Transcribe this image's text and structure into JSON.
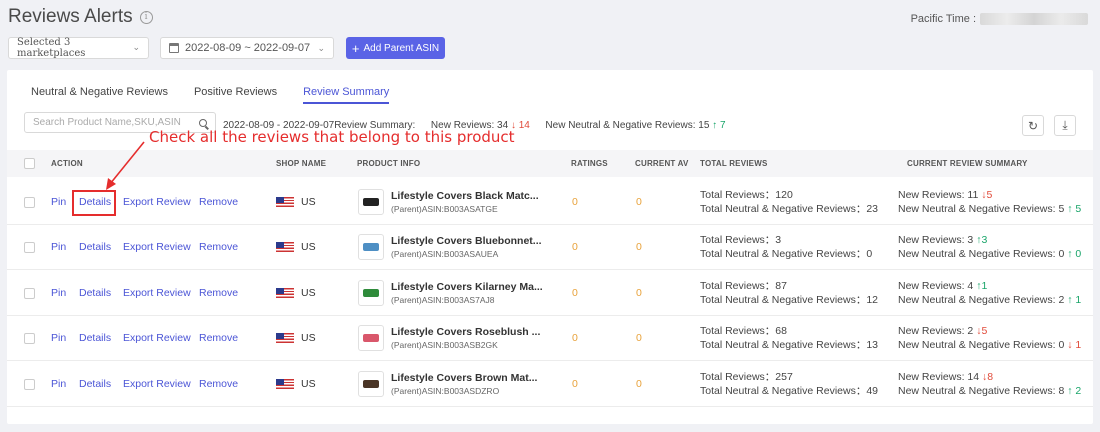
{
  "header": {
    "title": "Reviews Alerts",
    "pacific_label": "Pacific Time :"
  },
  "filters": {
    "marketplaces": "Selected 3 marketplaces",
    "date_range": "2022-08-09 ~ 2022-09-07",
    "add_button": "Add Parent ASIN"
  },
  "tabs": [
    {
      "label": "Neutral & Negative Reviews",
      "active": false
    },
    {
      "label": "Positive Reviews",
      "active": false
    },
    {
      "label": "Review Summary",
      "active": true
    }
  ],
  "search": {
    "placeholder": "Search Product Name,SKU,ASIN"
  },
  "summary": {
    "period": "2022-08-09 - 2022-09-07",
    "label": "Review Summary:",
    "new_reviews_label": "New Reviews: 34",
    "new_reviews_change": "14",
    "new_neg_label": "New Neutral & Negative Reviews: 15",
    "new_neg_change": "7"
  },
  "annotation": "Check all the reviews that belong to this product",
  "columns": {
    "action": "ACTION",
    "shop": "SHOP NAME",
    "product": "PRODUCT INFO",
    "ratings": "RATINGS",
    "current_av": "CURRENT AV",
    "total": "TOTAL REVIEWS",
    "current_summary": "CURRENT REVIEW SUMMARY"
  },
  "actions": {
    "pin": "Pin",
    "details": "Details",
    "export": "Export Review",
    "remove": "Remove"
  },
  "rows": [
    {
      "shop": "US",
      "name": "Lifestyle Covers Black Matc...",
      "asin": "(Parent)ASIN:B003ASATGE",
      "color": "#222222",
      "ratings": "0",
      "av": "0",
      "total": "Total Reviews：120",
      "total_neg": "Total Neutral & Negative Reviews：23",
      "new_label": "New Reviews: 11",
      "new_dir": "down",
      "new_val": "5",
      "neg_label": "New Neutral & Negative Reviews: 5",
      "neg_dir": "up",
      "neg_val": "5"
    },
    {
      "shop": "US",
      "name": "Lifestyle Covers Bluebonnet...",
      "asin": "(Parent)ASIN:B003ASAUEA",
      "color": "#4e8fc4",
      "ratings": "0",
      "av": "0",
      "total": "Total Reviews：3",
      "total_neg": "Total Neutral & Negative Reviews：0",
      "new_label": "New Reviews: 3",
      "new_dir": "up",
      "new_val": "3",
      "neg_label": "New Neutral & Negative Reviews: 0",
      "neg_dir": "up",
      "neg_val": "0"
    },
    {
      "shop": "US",
      "name": "Lifestyle Covers Kilarney Ma...",
      "asin": "(Parent)ASIN:B003AS7AJ8",
      "color": "#2e8b3a",
      "ratings": "0",
      "av": "0",
      "total": "Total Reviews：87",
      "total_neg": "Total Neutral & Negative Reviews：12",
      "new_label": "New Reviews: 4",
      "new_dir": "up",
      "new_val": "1",
      "neg_label": "New Neutral & Negative Reviews: 2",
      "neg_dir": "up",
      "neg_val": "1"
    },
    {
      "shop": "US",
      "name": "Lifestyle Covers Roseblush ...",
      "asin": "(Parent)ASIN:B003ASB2GK",
      "color": "#d9576b",
      "ratings": "0",
      "av": "0",
      "total": "Total Reviews：68",
      "total_neg": "Total Neutral & Negative Reviews：13",
      "new_label": "New Reviews: 2",
      "new_dir": "down",
      "new_val": "5",
      "neg_label": "New Neutral & Negative Reviews: 0",
      "neg_dir": "down",
      "neg_val": "1"
    },
    {
      "shop": "US",
      "name": "Lifestyle Covers Brown Mat...",
      "asin": "(Parent)ASIN:B003ASDZRO",
      "color": "#4a3526",
      "ratings": "0",
      "av": "0",
      "total": "Total Reviews：257",
      "total_neg": "Total Neutral & Negative Reviews：49",
      "new_label": "New Reviews: 14",
      "new_dir": "down",
      "new_val": "8",
      "neg_label": "New Neutral & Negative Reviews: 8",
      "neg_dir": "up",
      "neg_val": "2"
    }
  ]
}
